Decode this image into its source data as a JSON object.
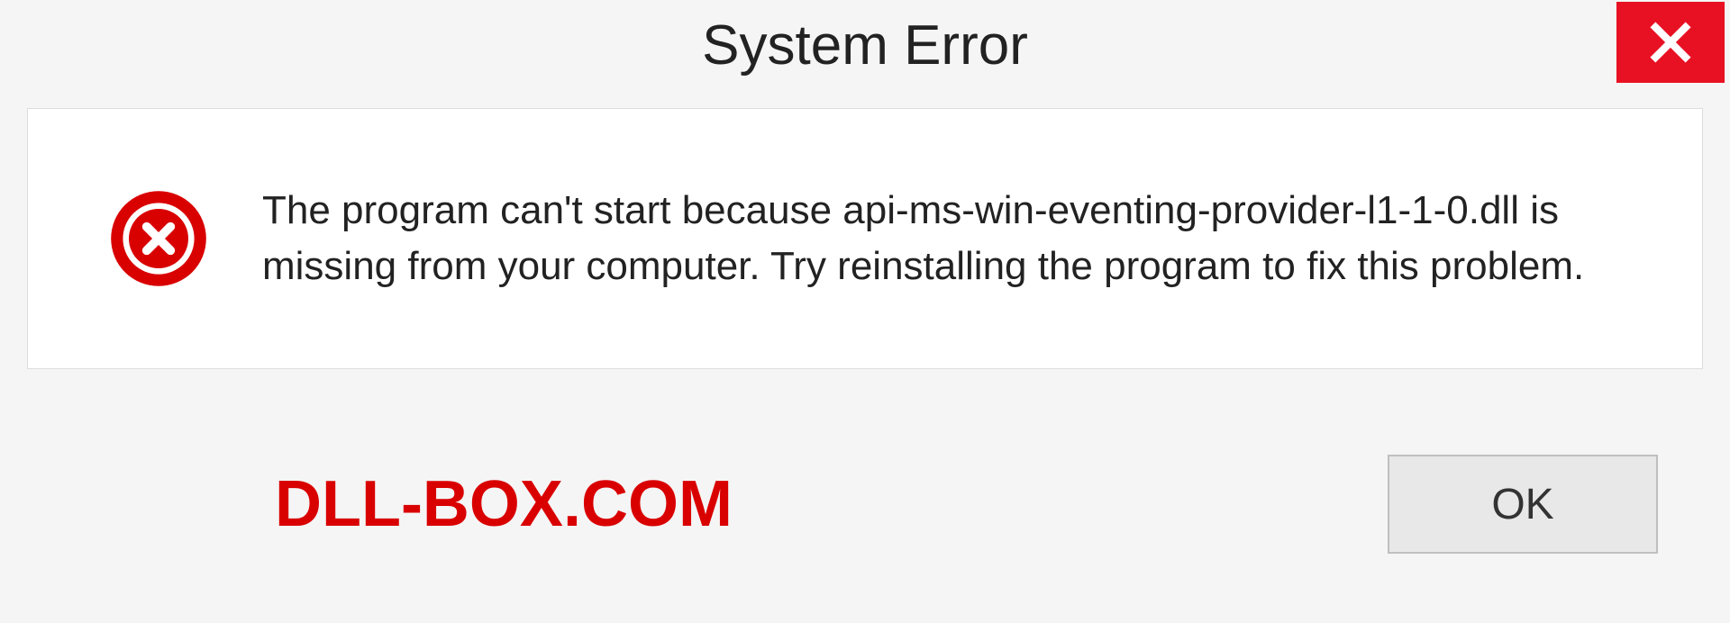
{
  "titlebar": {
    "title": "System Error"
  },
  "body": {
    "message": "The program can't start because api-ms-win-eventing-provider-l1-1-0.dll is missing from your computer. Try reinstalling the program to fix this problem."
  },
  "footer": {
    "watermark": "DLL-BOX.COM",
    "ok_label": "OK"
  },
  "colors": {
    "close_bg": "#e81123",
    "error_icon": "#d90000",
    "watermark": "#d90000"
  }
}
